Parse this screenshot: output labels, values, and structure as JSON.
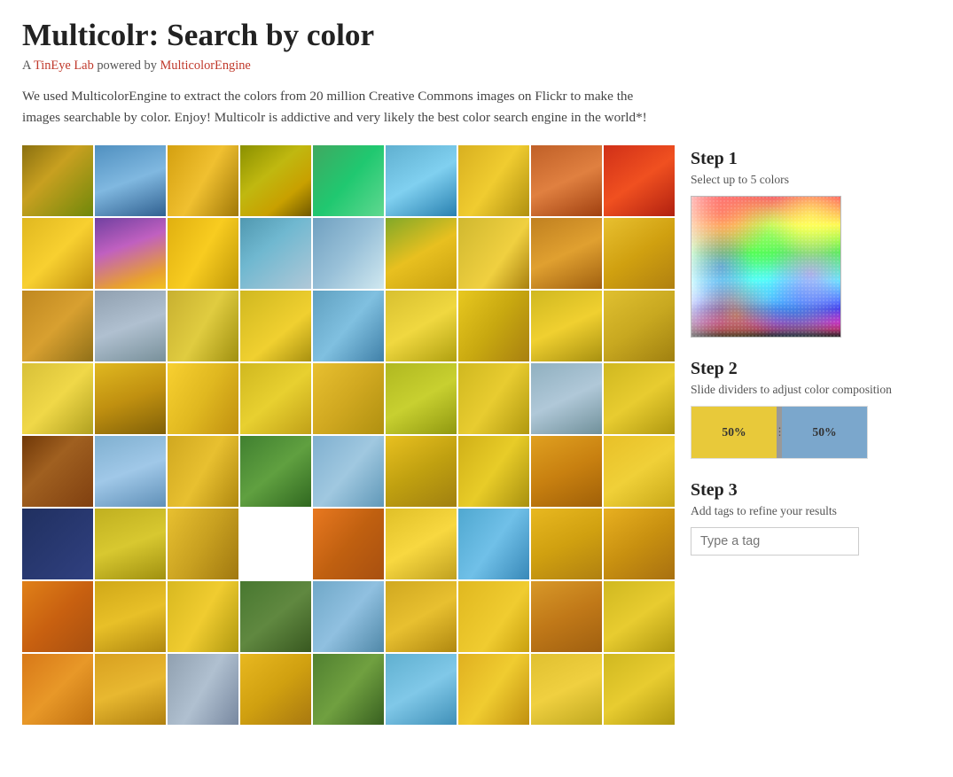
{
  "page": {
    "title": "Multicolr: Search by color",
    "subtitle_text": "A TinEye Lab powered by MulticolorEngine",
    "subtitle_link1_text": "TinEye Lab",
    "subtitle_link1_href": "#",
    "subtitle_link2_text": "MulticolorEngine",
    "subtitle_link2_href": "#",
    "intro_text": "We used MulticolorEngine to extract the colors from 20 million Creative Commons images on Flickr to make the images searchable by color. Enjoy! Multicolr is addictive and very likely the best color search engine in the world*!"
  },
  "sidebar": {
    "step1": {
      "title": "Step 1",
      "description": "Select up to 5 colors"
    },
    "step2": {
      "title": "Step 2",
      "description": "Slide dividers to adjust color composition",
      "color1_pct": "50%",
      "color2_pct": "50%"
    },
    "step3": {
      "title": "Step 3",
      "description": "Add tags to refine your results",
      "tag_placeholder": "Type a tag"
    }
  },
  "grid": {
    "photos": [
      {
        "color": "#c8a020",
        "color2": "#daa828"
      },
      {
        "color": "#5090c0",
        "color2": "#4080b0"
      },
      {
        "color": "#d4b030",
        "color2": "#e8c020"
      },
      {
        "color": "#e8c030",
        "color2": "#c09020"
      },
      {
        "color": "#88aa20",
        "color2": "#6a9018"
      },
      {
        "color": "#50a8d0",
        "color2": "#3890c0"
      },
      {
        "color": "#e0b820",
        "color2": "#c8a010"
      },
      {
        "color": "#c07030",
        "color2": "#a06020"
      },
      {
        "color": "#d04018",
        "color2": "#f05020"
      },
      {
        "color": "#e8c030",
        "color2": "#d4a820"
      },
      {
        "color": "#c0a030",
        "color2": "#e0b820"
      },
      {
        "color": "#e8c820",
        "color2": "#d4ac10"
      },
      {
        "color": "#60a030",
        "color2": "#50901c"
      },
      {
        "color": "#6090c0",
        "color2": "#4878b0"
      },
      {
        "color": "#e0c830",
        "color2": "#c8b020"
      },
      {
        "color": "#d08820",
        "color2": "#b87018"
      },
      {
        "color": "#80a840",
        "color2": "#6a8830"
      },
      {
        "color": "#e8c820",
        "color2": "#d0b010"
      }
    ]
  }
}
